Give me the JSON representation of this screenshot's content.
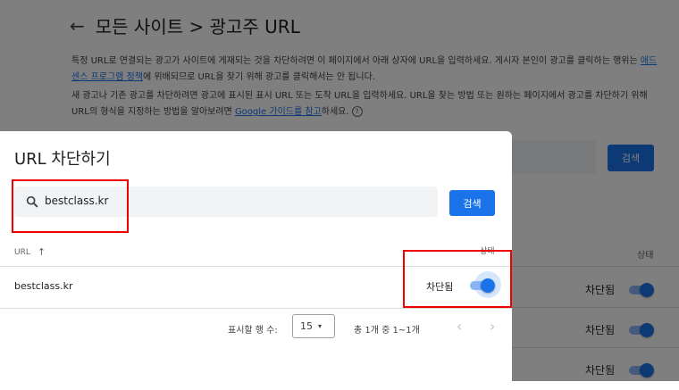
{
  "background": {
    "title": "모든 사이트 > 광고주 URL",
    "desc1_a": "특정 URL로 연결되는 광고가 사이트에 게재되는 것을 차단하려면 이 페이지에서 아래 상자에 URL을 입력하세요. 게시자 본인이 광고를 클릭하는 행위는 ",
    "desc1_link": "애드센스 프로그램 정책",
    "desc1_b": "에 위배되므로 URL을 찾기 위해 광고를 클릭해서는 안 됩니다.",
    "desc2_a": "새 광고나 기존 광고를 차단하려면 광고에 표시된 표시 URL 또는 도착 URL을 입력하세요. URL을 찾는 방법 또는 원하는 페이지에서 광고를 차단하기 위해 URL의 형식을 지정하는 방법을 알아보려면 ",
    "desc2_link": "Google 가이드를 참고",
    "desc2_b": "하세요.",
    "help_icon_glyph": "?",
    "search_button": "검색",
    "status_header": "상태",
    "rows": [
      "차단됨",
      "차단됨",
      "차단됨"
    ]
  },
  "dialog": {
    "title": "URL 차단하기",
    "search": {
      "value": "bestclass.kr",
      "icon": "search-icon"
    },
    "search_button": "검색",
    "columns": {
      "url": "URL",
      "sort_icon": "↑",
      "status": "상태"
    },
    "row": {
      "url": "bestclass.kr",
      "status": "차단됨",
      "toggle_on": true
    },
    "pagination": {
      "rows_label": "표시할 행 수:",
      "rows_value": "15",
      "caret": "▾",
      "range": "총 1개 중 1~1개",
      "prev": "‹",
      "next": "›"
    }
  },
  "colors": {
    "accent": "#1a73e8",
    "annotation": "#e00000"
  }
}
